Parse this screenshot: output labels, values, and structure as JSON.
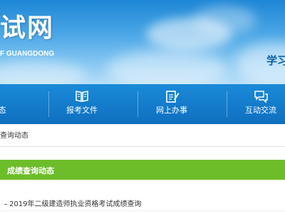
{
  "header": {
    "site_title": "试网",
    "site_subtitle": "F GUANGDONG",
    "slogan": "学习"
  },
  "nav": {
    "items": [
      {
        "label": "态",
        "icon": "news-icon"
      },
      {
        "label": "报考文件",
        "icon": "book-icon"
      },
      {
        "label": "网上办事",
        "icon": "edit-document-icon"
      },
      {
        "label": "互动交流",
        "icon": "chat-bubbles-icon"
      }
    ]
  },
  "breadcrumb": "查询动态",
  "section": {
    "title": "成绩查询动态"
  },
  "list": {
    "items": [
      {
        "title": "2019年二级建造师执业资格考试成绩查询"
      }
    ]
  },
  "colors": {
    "banner_blue": "#1d86d6",
    "nav_blue": "#0f6fbf",
    "section_green": "#6dbd2a",
    "slogan_blue": "#0d5fa8"
  }
}
